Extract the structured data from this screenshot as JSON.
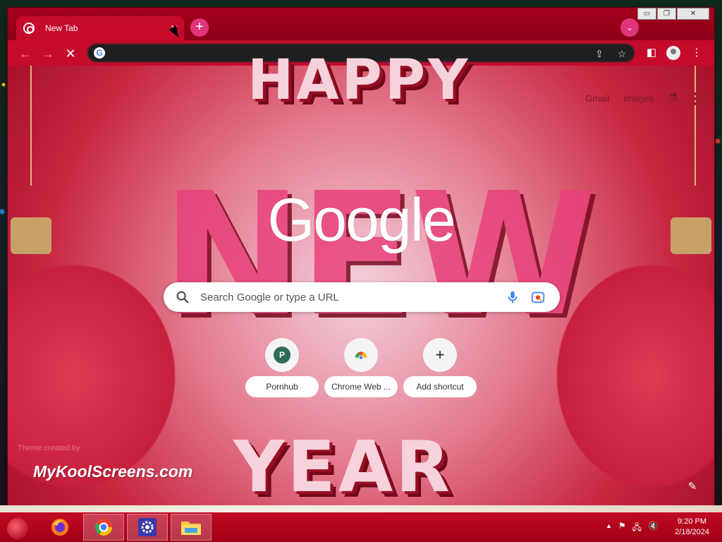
{
  "window": {
    "tab": {
      "title": "New Tab",
      "close_glyph": "✕"
    },
    "new_tab_glyph": "+",
    "tab_search_glyph": "⌄",
    "controls": {
      "minimize": "▭",
      "maximize": "❐",
      "close": "✕"
    }
  },
  "toolbar": {
    "back_glyph": "←",
    "forward_glyph": "→",
    "stop_glyph": "✕",
    "omnibox_value": "",
    "share_glyph": "⇪",
    "bookmark_glyph": "☆",
    "sidepanel_glyph": "◧",
    "menu_glyph": "⋮"
  },
  "ntp": {
    "top_links": {
      "gmail": "Gmail",
      "images": "Images"
    },
    "labs_glyph": "⚗",
    "logo_text": "Google",
    "search_placeholder": "Search Google or type a URL",
    "shortcuts": [
      {
        "label": "Pornhub",
        "badge": "P"
      },
      {
        "label": "Chrome Web ..."
      },
      {
        "label": "Add shortcut",
        "glyph": "+"
      }
    ],
    "theme_credit": "Theme created by",
    "watermark": "MyKoolScreens.com",
    "customize_glyph": "✎",
    "deco": {
      "top": "HAPPY",
      "middle": "NEW",
      "bottom": "YEAR"
    }
  },
  "taskbar": {
    "clock_time": "9:20 PM",
    "clock_date": "2/18/2024",
    "tray": {
      "chevron": "▲",
      "flag": "⚑",
      "network": "🖧",
      "volume": "🔇"
    }
  },
  "colors": {
    "accent": "#c60a2c",
    "taskbar": "#b3001f"
  }
}
